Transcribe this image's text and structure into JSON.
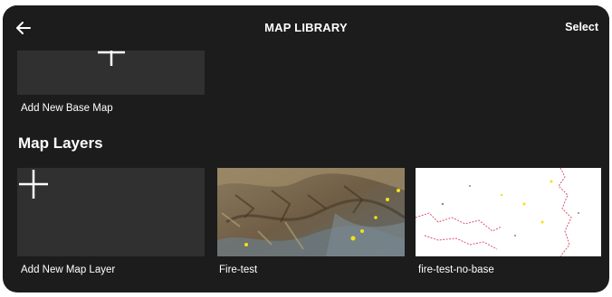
{
  "header": {
    "back_icon": "arrow-left-icon",
    "title": "MAP LIBRARY",
    "select_label": "Select"
  },
  "base_maps": {
    "add_icon": "plus-icon",
    "add_label": "Add New Base Map"
  },
  "map_layers": {
    "section_title": "Map Layers",
    "items": [
      {
        "label": "Add New Map Layer",
        "icon": "plus-icon"
      },
      {
        "label": "Fire-test",
        "thumbnail": "terrain-map-thumbnail"
      },
      {
        "label": "fire-test-no-base",
        "thumbnail": "boundary-map-thumbnail"
      }
    ]
  },
  "colors": {
    "background": "#1c1c1c",
    "tile": "#303030",
    "text": "#ffffff",
    "fire_marker": "#f2e11a",
    "boundary": "#d9536f"
  }
}
